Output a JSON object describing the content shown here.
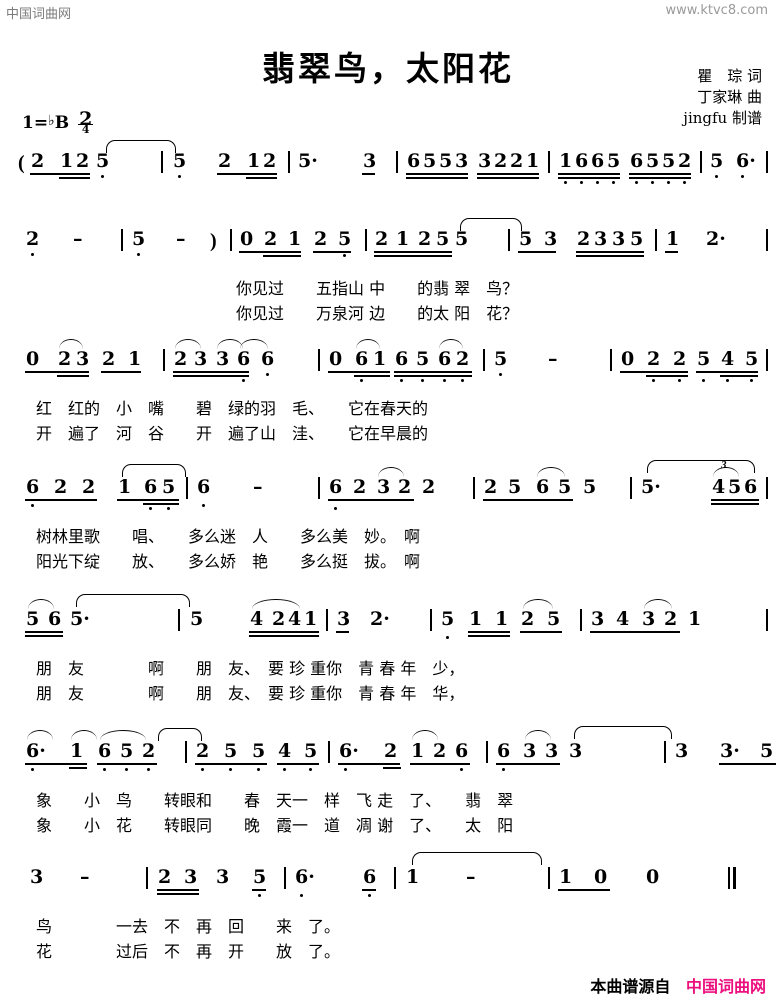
{
  "watermark": {
    "top_left": "中国词曲网",
    "top_right": "www.ktvc8.com"
  },
  "header": {
    "title": "翡翠鸟，太阳花",
    "lyricist": "瞿　琮 词",
    "composer": "丁家琳 曲",
    "engraver": "jingfu 制谱"
  },
  "key_signature": {
    "prefix": "1=",
    "flat": "♭",
    "key": "B",
    "meter_numerator": "2",
    "meter_denominator": "4"
  },
  "score": {
    "lines": [
      {
        "id": "line-1",
        "notes": "( 2 12 5̣   5̣   2 12 | 5· 3 | 6553 3221 | 1̣6̣6̣5̣ 6̣5̣5̣2̣ | 5̣ 6̣·",
        "lyric_row_1": "",
        "lyric_row_2": ""
      },
      {
        "id": "line-2",
        "notes": "2̣ -  | 5̣ - )  | 0 2 1 2 5̣ | 2 1 2 5 5 | 5 3 2335 | 1 2·",
        "lyric_row_1": "你见过　　五指山 中　　的翡 翠　鸟？",
        "lyric_row_2": "你见过　　万泉河 边　　的太 阳　花？"
      },
      {
        "id": "line-3",
        "notes": "0 23 2 1 | 2 3 3 6̣ 6̣ | 0 6̣1 6̣ 5̣ 6̣2̣ | 5̣ - | 0 2̣ 2̣ 5̣ 4̣ 5̣",
        "lyric_row_1": "红　红的　小　嘴　　碧　绿的羽　毛、　　它在春天的",
        "lyric_row_2": "开　遍了　河　谷　　开　遍了山　洼、　　它在早晨的"
      },
      {
        "id": "line-4",
        "notes": "6̣ 2 2 1 6̣5̣ | 6̣ - | 6̣ 2 3 2 2 | 2 5 6 5 5 | 5· 456",
        "lyric_row_1": "树林里歌　　唱、　　多么迷　人　　多么美　妙。　啊",
        "lyric_row_2": "阳光下绽　　放、　　多么娇　艳　　多么挺　拔。　啊",
        "triplet": "3"
      },
      {
        "id": "line-5",
        "notes": "5 6 5·  5 | 4 241 | 3 2· | 5̣ 1 1 2 5 | 3 4 3 2 1",
        "lyric_row_1": "朋　友　　　　啊　　朋　友、　要 珍 重你　青 春 年　少，",
        "lyric_row_2": "朋　友　　　　啊　　朋　友、　要 珍 重你　青 春 年　华，"
      },
      {
        "id": "line-6",
        "notes": "6̣· 1 6̣5̣2̣ | 2̣ 5̣ 5̣ 4̣ 5̣ | 6̣· 2 126̣ | 6̣ 3 3 3  3 | 3· 5",
        "lyric_row_1": "象　　小　鸟　　转眼和　　春　天一　样　飞 走　了、　　翡　翠",
        "lyric_row_2": "象　　小　花　　转眼同　　晚　霞一　道　凋 谢　了、　　太　阳"
      },
      {
        "id": "line-7",
        "notes": "3 - | 23 3 5̣ | 6̣· 6̣ | 1 - | 1 0 0 ‖",
        "lyric_row_1": "鸟　　　　一去　不　再　回　　来　了。",
        "lyric_row_2": "花　　　　过后　不　再　开　　放　了。"
      }
    ]
  },
  "footer": {
    "source_label": "本曲谱源自",
    "site_name": "中国词曲网"
  },
  "colors": {
    "site_pink": "#ec0f7e",
    "watermark_gray": "#7b7b7b",
    "ink": "#000000"
  }
}
